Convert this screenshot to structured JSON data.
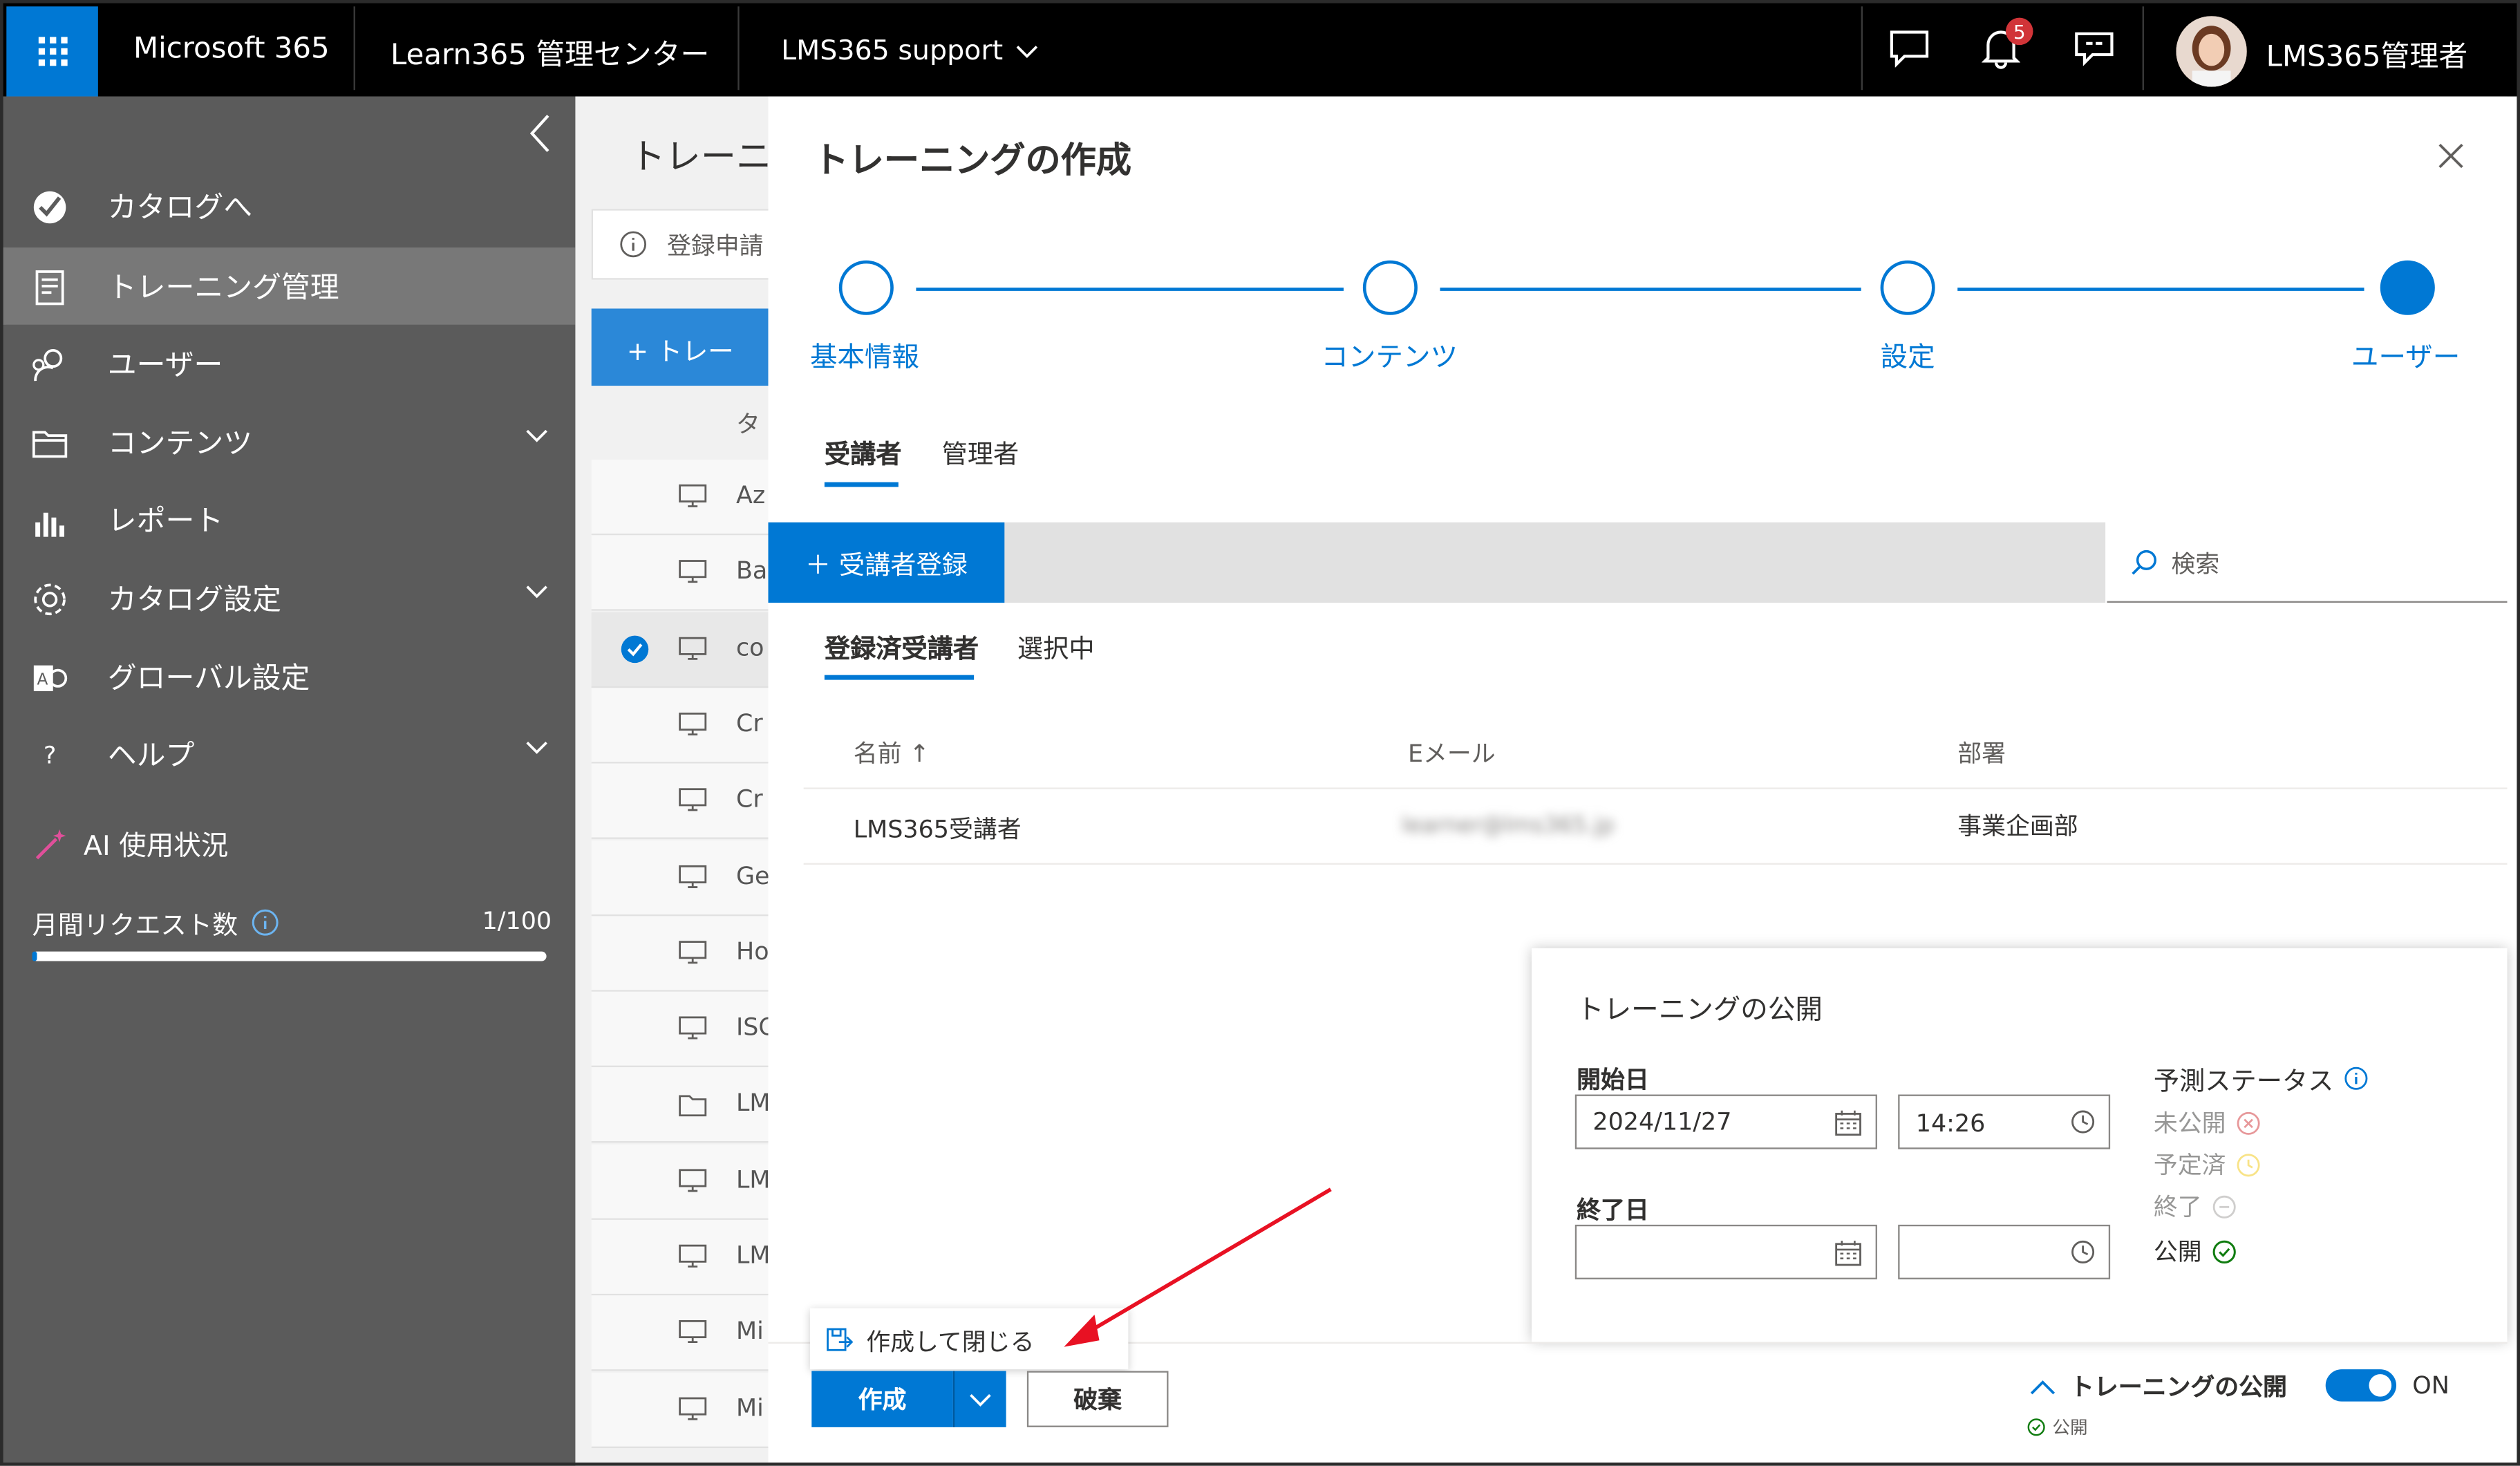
{
  "topbar": {
    "brand": "Microsoft 365",
    "app": "Learn365 管理センター",
    "tenant": "LMS365 support",
    "notification_count": "5",
    "user_name": "LMS365管理者"
  },
  "sidebar": {
    "items": [
      {
        "label": "カタログへ"
      },
      {
        "label": "トレーニング管理"
      },
      {
        "label": "ユーザー"
      },
      {
        "label": "コンテンツ"
      },
      {
        "label": "レポート"
      },
      {
        "label": "カタログ設定"
      },
      {
        "label": "グローバル設定"
      },
      {
        "label": "ヘルプ"
      }
    ],
    "help_glyph": "?",
    "ai_section": {
      "title": "AI 使用状況",
      "metric_label": "月間リクエスト数",
      "metric_value": "1/100",
      "usage_fraction": 0.01
    }
  },
  "background_page": {
    "title": "トレーニン",
    "info_text": "登録申請",
    "new_button": "+ トレー",
    "col_header": "タ",
    "rows": [
      "Az",
      "Ba",
      "co",
      "Cr",
      "Cr",
      "Ge",
      "Ho",
      "ISC",
      "LM",
      "LM",
      "LM",
      "Mi",
      "Mi"
    ]
  },
  "panel": {
    "title": "トレーニングの作成",
    "steps": [
      "基本情報",
      "コンテンツ",
      "設定",
      "ユーザー"
    ],
    "active_step": 3,
    "tabs": [
      "受講者",
      "管理者"
    ],
    "add_button": "＋ 受講者登録",
    "search_placeholder": "検索",
    "subtabs": [
      "登録済受講者",
      "選択中"
    ],
    "table": {
      "headers": [
        "名前 ↑",
        "Eメール",
        "部署"
      ],
      "rows": [
        {
          "name": "LMS365受講者",
          "email": "learner@lms365.jp",
          "dept": "事業企画部"
        }
      ]
    },
    "publish_card": {
      "title": "トレーニングの公開",
      "start_label": "開始日",
      "start_date": "2024/11/27",
      "start_time": "14:26",
      "end_label": "終了日",
      "end_date": "",
      "end_time": "",
      "status_title": "予測ステータス",
      "statuses": [
        {
          "label": "未公開",
          "color": "#d13438"
        },
        {
          "label": "予定済",
          "color": "#f2c811"
        },
        {
          "label": "終了",
          "color": "#a19f9d"
        },
        {
          "label": "公開",
          "color": "#107c10"
        }
      ]
    },
    "footer": {
      "dropdown_item": "作成して閉じる",
      "create_button": "作成",
      "discard_button": "破棄",
      "publish_toggle_label": "トレーニングの公開",
      "publish_state": "ON",
      "publish_sub": "公開"
    }
  },
  "colors": {
    "accent": "#0078d4",
    "topbar": "#000000",
    "sidebar": "#5b5b5b",
    "arrow": "#e81123"
  }
}
